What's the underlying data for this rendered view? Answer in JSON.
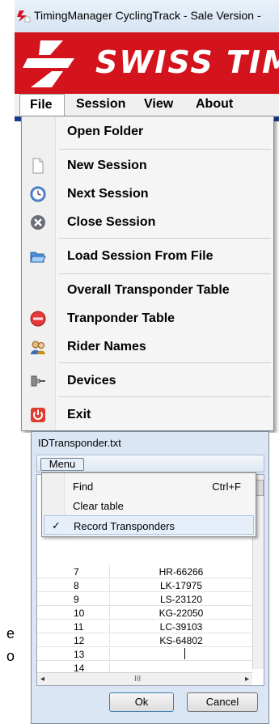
{
  "app": {
    "title": "TimingManager CyclingTrack - Sale Version -",
    "brand": "SWISS TIM",
    "colors": {
      "brand_red": "#d4141c",
      "accent_blue": "#1d3a8a"
    }
  },
  "menubar": {
    "items": [
      "File",
      "Session",
      "View",
      "About"
    ]
  },
  "file_menu": {
    "items": [
      {
        "label": "Open Folder",
        "icon": "none"
      },
      {
        "label": "New Session",
        "icon": "blank-document-icon"
      },
      {
        "label": "Next Session",
        "icon": "clock-icon"
      },
      {
        "label": "Close Session",
        "icon": "close-circle-icon"
      },
      {
        "label": "Load Session From File",
        "icon": "open-folder-icon"
      },
      {
        "label": "Overall Transponder Table",
        "icon": "none"
      },
      {
        "label": "Tranponder Table",
        "icon": "red-circle-icon"
      },
      {
        "label": "Rider Names",
        "icon": "users-icon"
      },
      {
        "label": "Devices",
        "icon": "device-icon"
      },
      {
        "label": "Exit",
        "icon": "power-icon"
      }
    ]
  },
  "dialog": {
    "title": "IDTransponder.txt",
    "menu_button": "Menu",
    "context_menu": {
      "items": [
        {
          "label": "Find",
          "shortcut": "Ctrl+F"
        },
        {
          "label": "Clear table",
          "shortcut": ""
        },
        {
          "label": "Record Transponders",
          "shortcut": "",
          "checked": "✓"
        }
      ]
    },
    "rows": [
      {
        "num": "7",
        "value": "HR-66266"
      },
      {
        "num": "8",
        "value": "LK-17975"
      },
      {
        "num": "9",
        "value": "LS-23120"
      },
      {
        "num": "10",
        "value": "KG-22050"
      },
      {
        "num": "11",
        "value": "LC-39103"
      },
      {
        "num": "12",
        "value": "KS-64802"
      },
      {
        "num": "13",
        "value": ""
      },
      {
        "num": "14",
        "value": ""
      }
    ],
    "scroll_left": "◂",
    "scroll_right": "▸",
    "scroll_thumb": "III",
    "ok_label": "Ok",
    "cancel_label": "Cancel"
  },
  "side_fragments": {
    "top": "e",
    "bottom": "o"
  }
}
